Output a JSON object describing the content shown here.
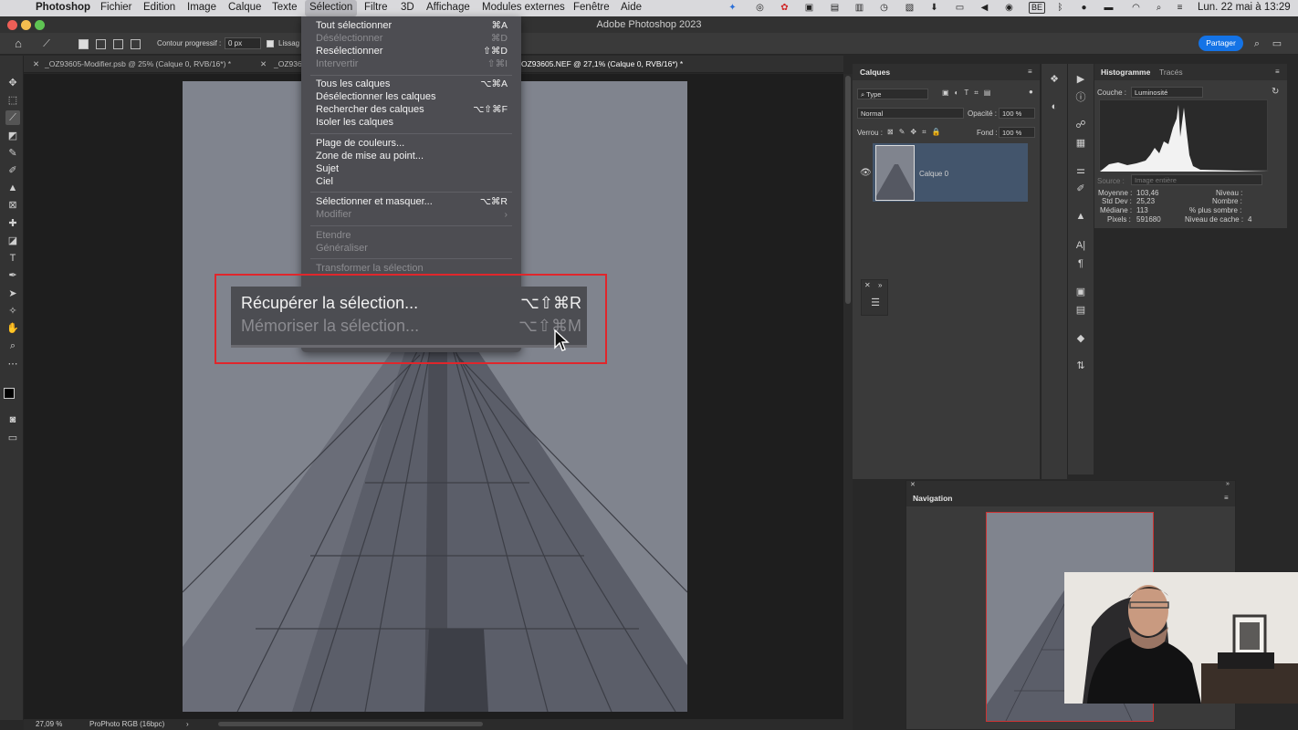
{
  "menubar": {
    "app": "Photoshop",
    "items": [
      "Fichier",
      "Edition",
      "Image",
      "Calque",
      "Texte",
      "Sélection",
      "Filtre",
      "3D",
      "Affichage",
      "Modules externes",
      "Fenêtre",
      "Aide"
    ],
    "keyboard": "BE",
    "clock": "Lun. 22 mai à 13:29"
  },
  "window": {
    "title": "Adobe Photoshop 2023"
  },
  "options": {
    "feather_label": "Contour progressif :",
    "feather_value": "0 px",
    "antialias_label": "Lissag",
    "share_label": "Partager"
  },
  "tabs": [
    "_OZ93605-Modifier.psb @ 25% (Calque 0, RVB/16*) *",
    "_OZ936",
    "OZ93605.NEF @ 27,1% (Calque 0, RVB/16*) *"
  ],
  "selection_menu": {
    "group1": [
      {
        "label": "Tout sélectionner",
        "shortcut": "⌘A",
        "disabled": false
      },
      {
        "label": "Désélectionner",
        "shortcut": "⌘D",
        "disabled": true
      },
      {
        "label": "Resélectionner",
        "shortcut": "⇧⌘D",
        "disabled": false
      },
      {
        "label": "Intervertir",
        "shortcut": "⇧⌘I",
        "disabled": true
      }
    ],
    "group2": [
      {
        "label": "Tous les calques",
        "shortcut": "⌥⌘A",
        "disabled": false
      },
      {
        "label": "Désélectionner les calques",
        "shortcut": "",
        "disabled": false
      },
      {
        "label": "Rechercher des calques",
        "shortcut": "⌥⇧⌘F",
        "disabled": false
      },
      {
        "label": "Isoler les calques",
        "shortcut": "",
        "disabled": false
      }
    ],
    "group3": [
      {
        "label": "Plage de couleurs...",
        "shortcut": "",
        "disabled": false
      },
      {
        "label": "Zone de mise au point...",
        "shortcut": "",
        "disabled": false
      },
      {
        "label": "Sujet",
        "shortcut": "",
        "disabled": false
      },
      {
        "label": "Ciel",
        "shortcut": "",
        "disabled": false
      }
    ],
    "group4": [
      {
        "label": "Sélectionner et masquer...",
        "shortcut": "⌥⌘R",
        "disabled": false
      },
      {
        "label": "Modifier",
        "shortcut": "›",
        "disabled": true
      }
    ],
    "group5": [
      {
        "label": "Etendre",
        "shortcut": "",
        "disabled": true
      },
      {
        "label": "Généraliser",
        "shortcut": "",
        "disabled": true
      }
    ],
    "group6": [
      {
        "label": "Transformer la sélection",
        "shortcut": "",
        "disabled": true
      }
    ],
    "zoomed": [
      {
        "label": "Récupérer la sélection...",
        "shortcut": "⌥⇧⌘R",
        "disabled": false
      },
      {
        "label": "Mémoriser la sélection...",
        "shortcut": "⌥⇧⌘M",
        "disabled": true
      }
    ]
  },
  "status": {
    "zoom": "27,09 %",
    "profile": "ProPhoto RGB (16bpc)"
  },
  "layers_panel": {
    "tab": "Calques",
    "filter": "Type",
    "blend": "Normal",
    "opacity_label": "Opacité :",
    "opacity_value": "100 %",
    "lock_label": "Verrou :",
    "fill_label": "Fond :",
    "fill_value": "100 %",
    "layer_name": "Calque 0"
  },
  "histogram_panel": {
    "tab_active": "Histogramme",
    "tab_other": "Tracés",
    "channel_label": "Couche :",
    "channel_value": "Luminosité",
    "source_label": "Source :",
    "source_value": "Image entière",
    "stats_left": [
      {
        "label": "Moyenne :",
        "value": "103,46"
      },
      {
        "label": "Std Dev :",
        "value": "25,23"
      },
      {
        "label": "Médiane :",
        "value": "113"
      },
      {
        "label": "Pixels :",
        "value": "591680"
      }
    ],
    "stats_right": [
      {
        "label": "Niveau :",
        "value": ""
      },
      {
        "label": "Nombre :",
        "value": ""
      },
      {
        "label": "% plus sombre :",
        "value": ""
      },
      {
        "label": "Niveau de cache :",
        "value": "4"
      }
    ]
  },
  "navigation_panel": {
    "tab": "Navigation"
  },
  "colors": {
    "accent": "#1473e6",
    "callout": "#e0262b",
    "layer_selected": "#43556c"
  }
}
